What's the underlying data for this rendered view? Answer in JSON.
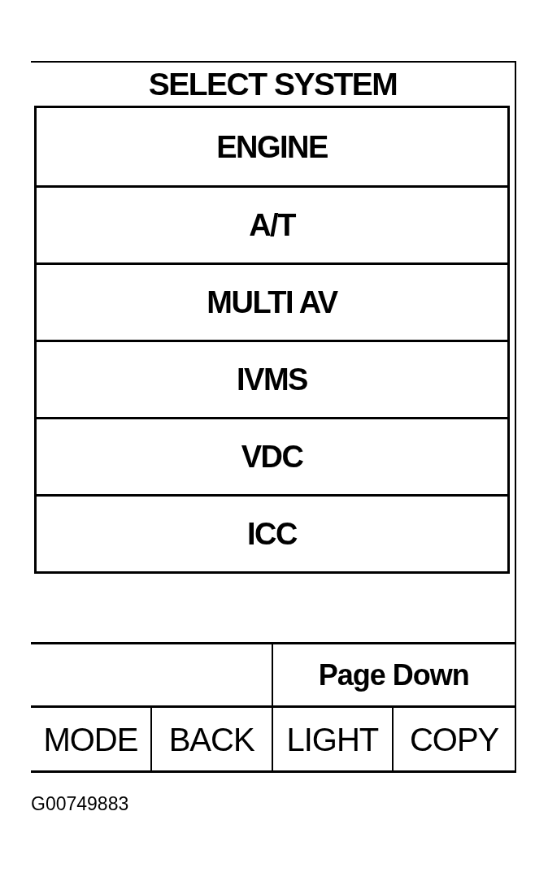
{
  "screen": {
    "title": "SELECT SYSTEM",
    "systems": [
      "ENGINE",
      "A/T",
      "MULTI AV",
      "IVMS",
      "VDC",
      "ICC"
    ],
    "page_down_key": "Page Down",
    "soft_keys": [
      "MODE",
      "BACK",
      "LIGHT",
      "COPY"
    ]
  },
  "figure_id": "G00749883"
}
